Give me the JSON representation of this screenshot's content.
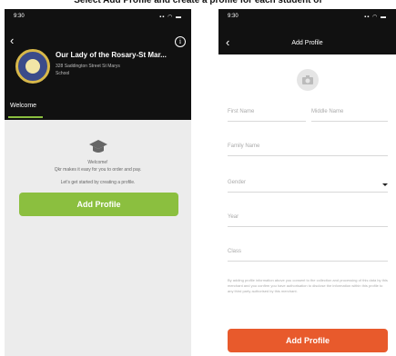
{
  "caption": "Select Add Profile and create a profile for each student of",
  "left": {
    "status": {
      "time": "9:30",
      "signal": "▪▪ ◠ ▬"
    },
    "school": {
      "name": "Our Lady of the Rosary-St Mar...",
      "address": "328 Saddington Street St Marys",
      "type": "School"
    },
    "tabs": [
      {
        "label": "Welcome",
        "active": true
      }
    ],
    "welcome_title": "Welcome!",
    "welcome_body": "Qkr makes it easy for you to order and pay.",
    "welcome_hint": "Let's get started by creating a profile.",
    "add_profile_button": "Add Profile",
    "accent": "#8bbf3f"
  },
  "right": {
    "status": {
      "time": "9:30",
      "signal": "▪▪ ◠ ▬"
    },
    "title": "Add Profile",
    "fields": {
      "first_name": "First Name",
      "middle_name": "Middle Name",
      "family_name": "Family Name",
      "gender": "Gender",
      "year": "Year",
      "class": "Class"
    },
    "consent": "By adding profile information above you consent to the collection and processing of this data by this merchant and you confirm you have authorisation to disclose the information within this profile to any third party authorised by this merchant.",
    "add_profile_button": "Add Profile",
    "accent": "#e85a2c"
  }
}
